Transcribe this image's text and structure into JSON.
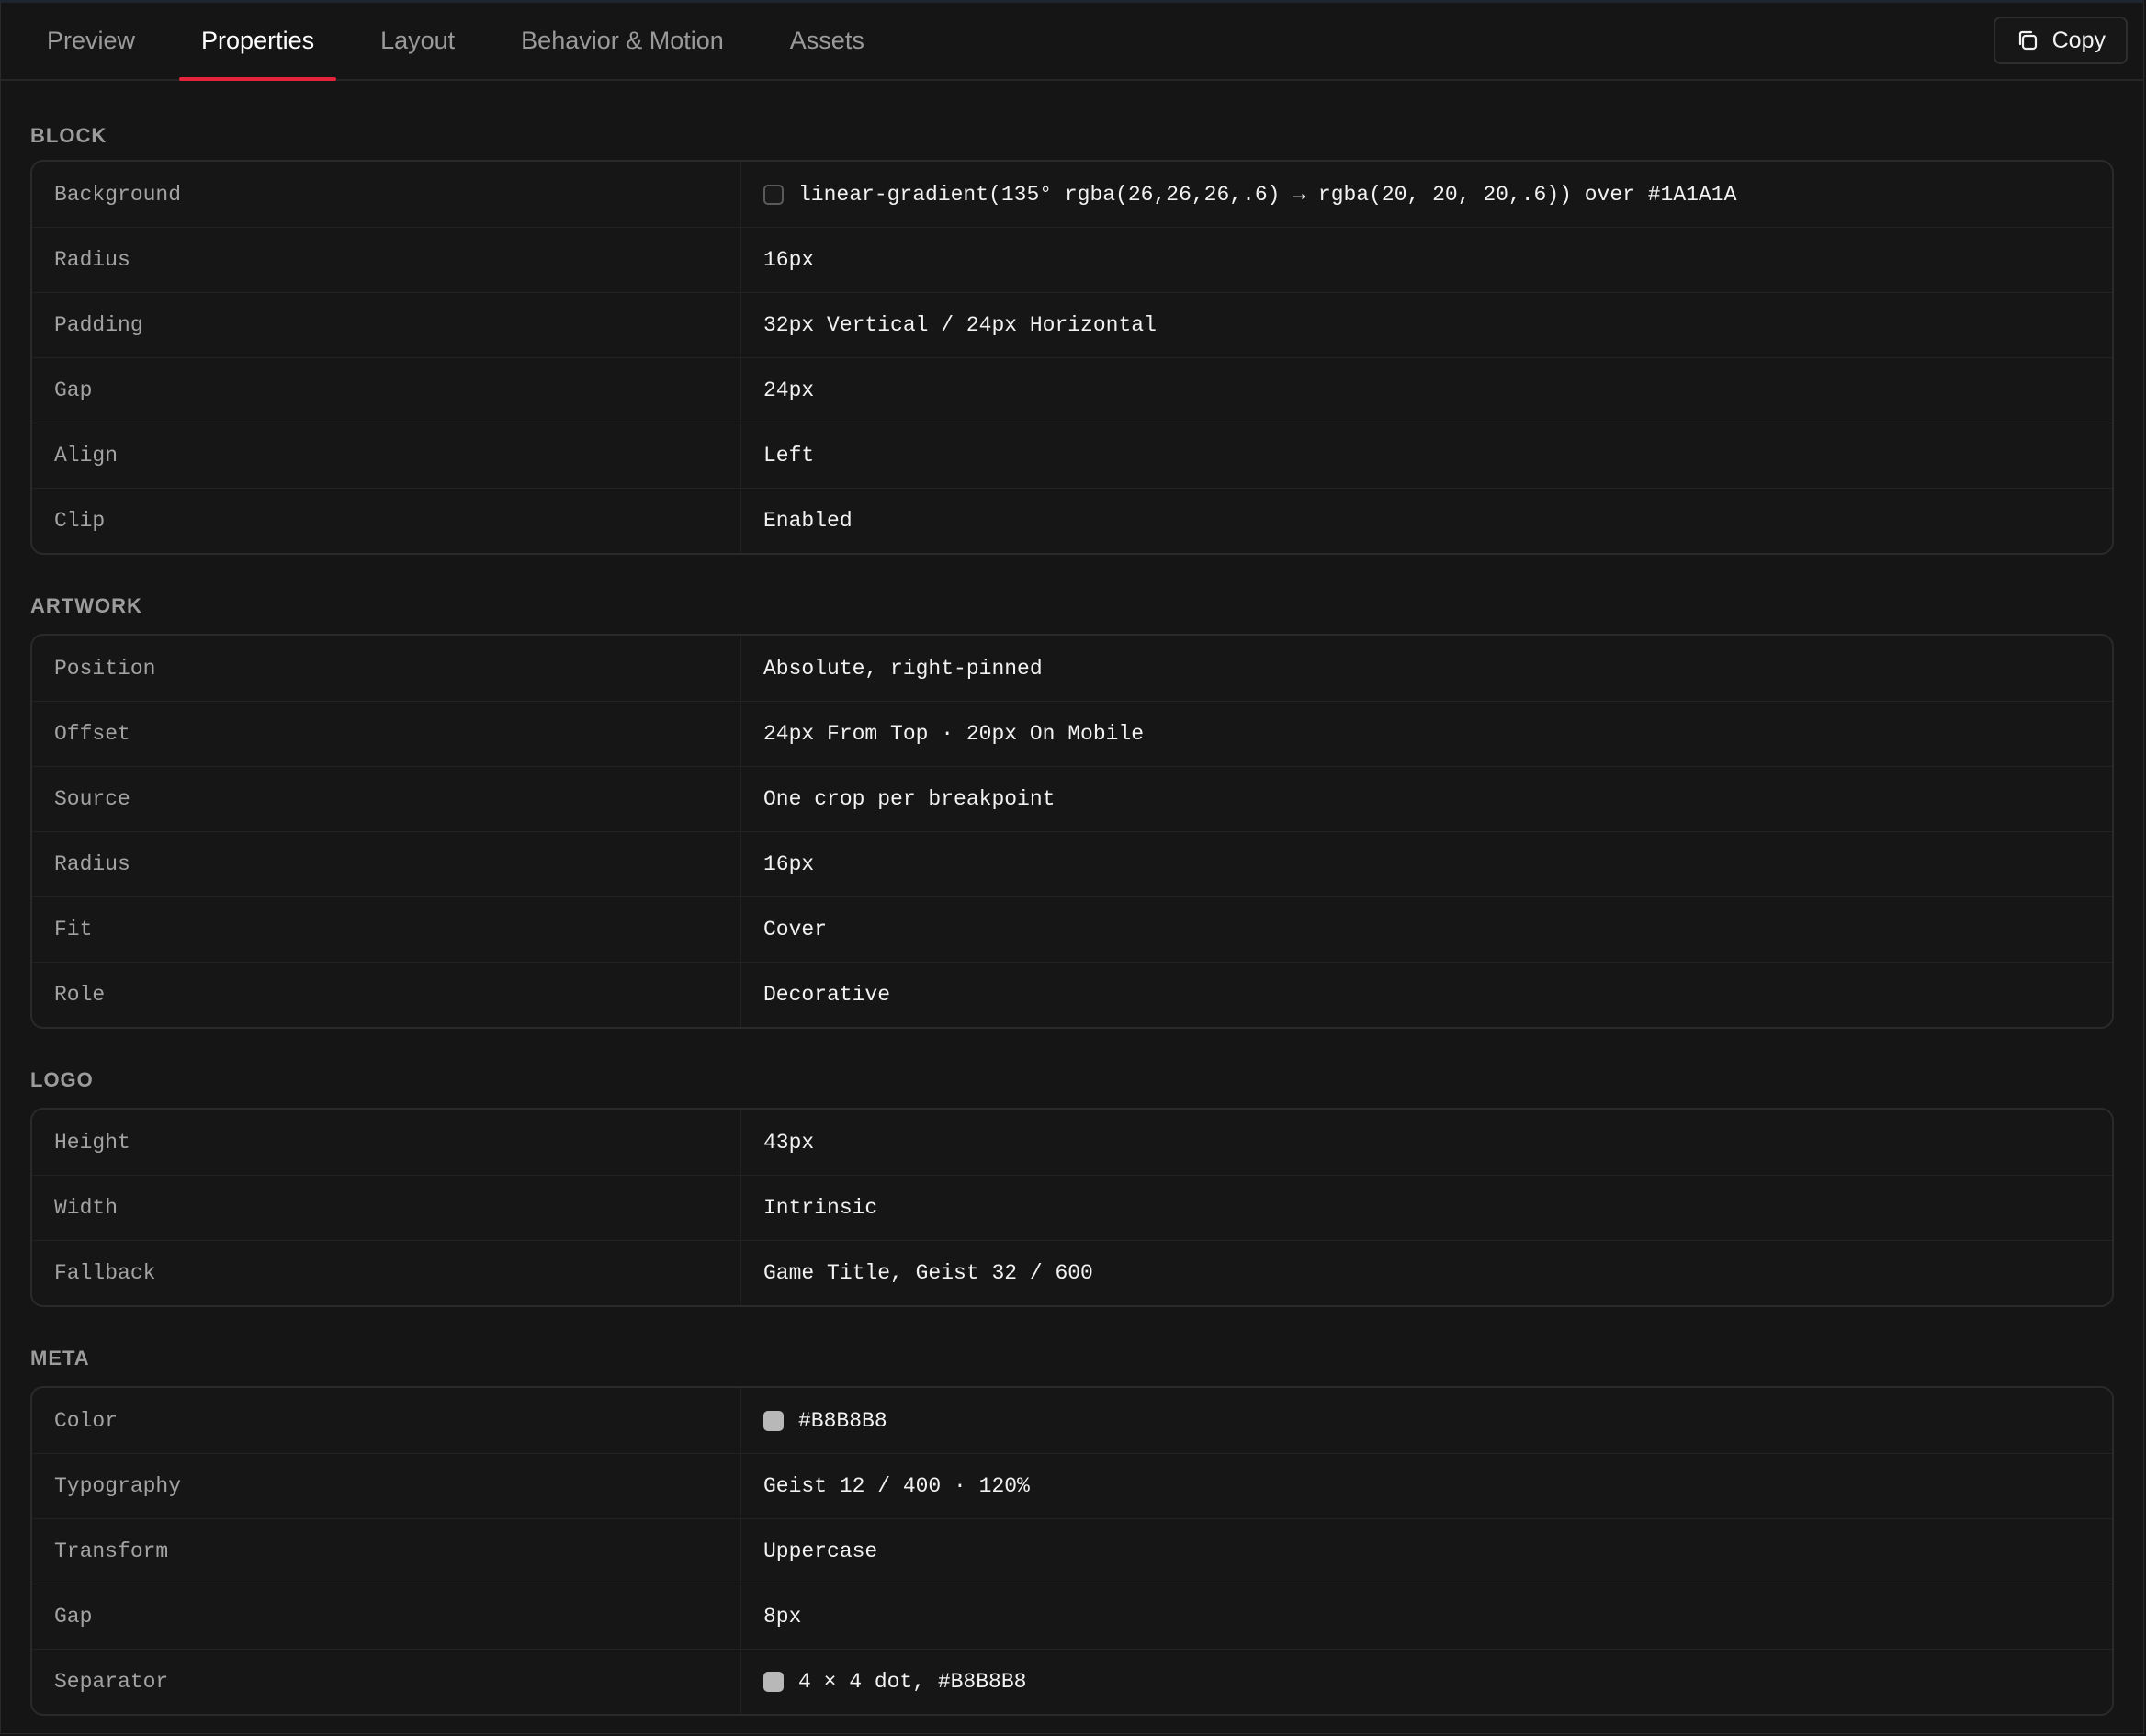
{
  "tabs": [
    {
      "label": "Preview",
      "active": false
    },
    {
      "label": "Properties",
      "active": true
    },
    {
      "label": "Layout",
      "active": false
    },
    {
      "label": "Behavior & Motion",
      "active": false
    },
    {
      "label": "Assets",
      "active": false
    }
  ],
  "toolbar": {
    "copy_label": "Copy",
    "copy_icon": "copy-icon"
  },
  "colors": {
    "accent": "#E5243B",
    "background": "#151515",
    "swatch_grey": "#B8B8B8"
  },
  "sections": {
    "block": {
      "title": "BLOCK",
      "rows": [
        {
          "label": "Background",
          "value": "linear-gradient(135° rgba(26,26,26,.6) → rgba(20, 20, 20,.6)) over #1A1A1A",
          "swatch": "#1A1A1A"
        },
        {
          "label": "Radius",
          "value": "16px"
        },
        {
          "label": "Padding",
          "value": "32px Vertical / 24px Horizontal"
        },
        {
          "label": "Gap",
          "value": "24px"
        },
        {
          "label": "Align",
          "value": "Left"
        },
        {
          "label": "Clip",
          "value": "Enabled"
        }
      ]
    },
    "artwork": {
      "title": "ARTWORK",
      "rows": [
        {
          "label": "Position",
          "value": "Absolute, right-pinned"
        },
        {
          "label": "Offset",
          "value": "24px From Top · 20px On Mobile"
        },
        {
          "label": "Source",
          "value": "One crop per breakpoint"
        },
        {
          "label": "Radius",
          "value": "16px"
        },
        {
          "label": "Fit",
          "value": "Cover"
        },
        {
          "label": "Role",
          "value": "Decorative"
        }
      ]
    },
    "logo": {
      "title": "LOGO",
      "rows": [
        {
          "label": "Height",
          "value": "43px"
        },
        {
          "label": "Width",
          "value": "Intrinsic"
        },
        {
          "label": "Fallback",
          "value": "Game Title, Geist 32 / 600"
        }
      ]
    },
    "meta": {
      "title": "META",
      "rows": [
        {
          "label": "Color",
          "value": "#B8B8B8",
          "swatch": "#B8B8B8"
        },
        {
          "label": "Typography",
          "value": "Geist 12 / 400 · 120%"
        },
        {
          "label": "Transform",
          "value": "Uppercase"
        },
        {
          "label": "Gap",
          "value": "8px"
        },
        {
          "label": "Separator",
          "value": "4 × 4 dot, #B8B8B8",
          "swatch": "#B8B8B8"
        }
      ]
    }
  }
}
